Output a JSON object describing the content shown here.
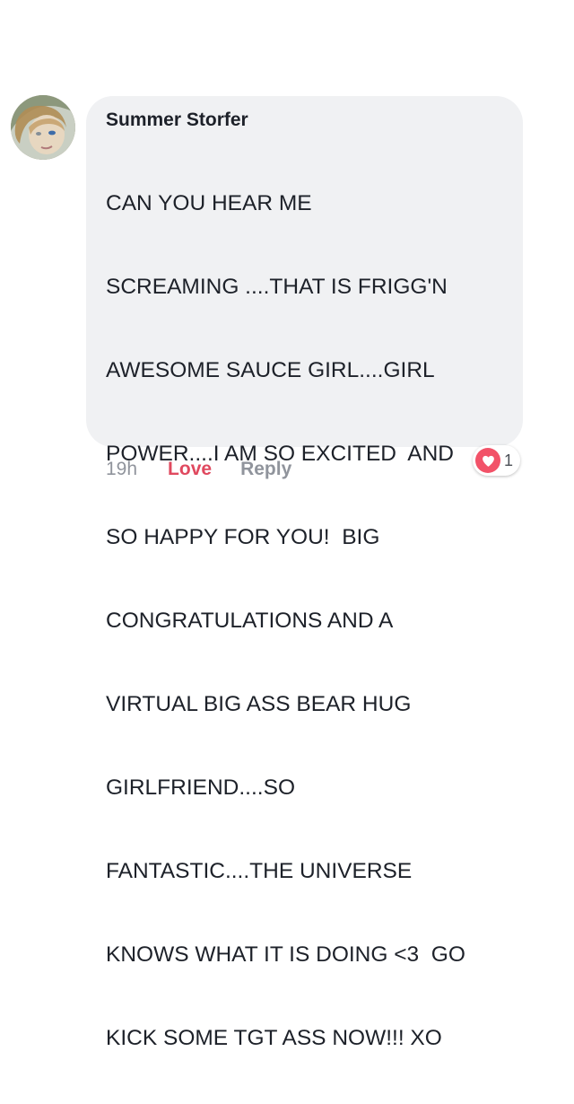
{
  "comment": {
    "author": "Summer Storfer",
    "text_lines": [
      "CAN YOU HEAR ME",
      "SCREAMING ....THAT IS FRIGG'N",
      "AWESOME SAUCE GIRL....GIRL",
      "POWER....I AM SO EXCITED  AND",
      "SO HAPPY FOR YOU!  BIG",
      "CONGRATULATIONS AND A",
      "VIRTUAL BIG ASS BEAR HUG",
      "GIRLFRIEND....SO",
      "FANTASTIC....THE UNIVERSE",
      "KNOWS WHAT IT IS DOING <3  GO",
      "KICK SOME TGT ASS NOW!!! XO"
    ],
    "avatar_icon": "profile-photo"
  },
  "actions": {
    "time": "19h",
    "love_label": "Love",
    "reply_label": "Reply"
  },
  "reactions": {
    "icon": "heart-icon",
    "count": "1"
  },
  "colors": {
    "bubble_bg": "#f0f1f3",
    "text": "#1d2129",
    "muted": "#90949c",
    "love": "#e0495f",
    "heart_badge": "#f25268"
  }
}
